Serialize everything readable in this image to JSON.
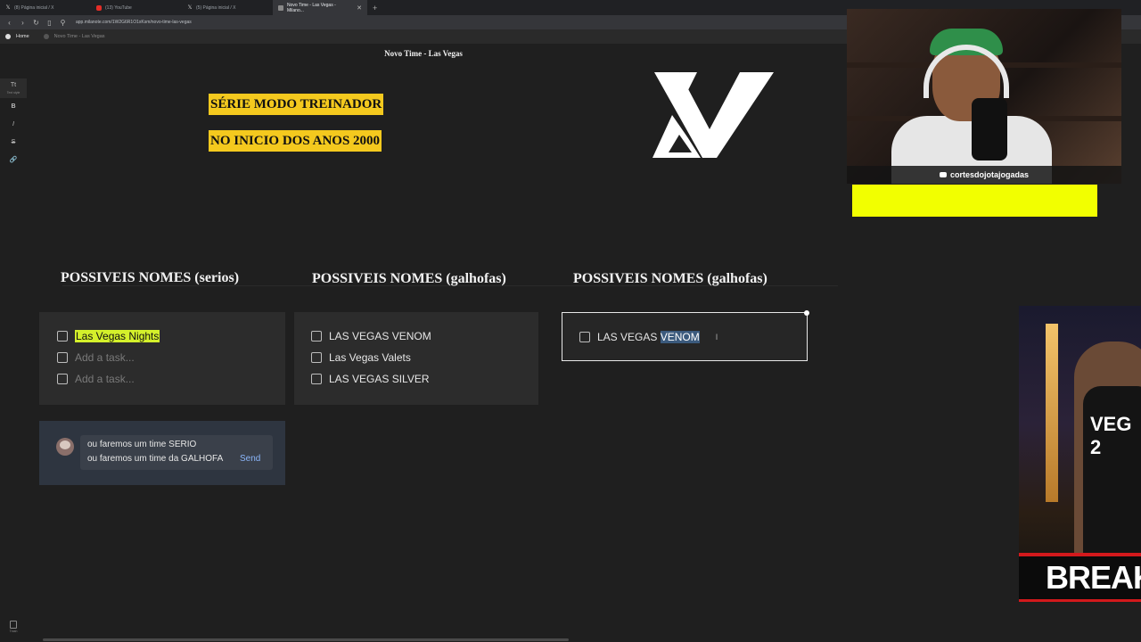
{
  "browser": {
    "tabs": [
      {
        "title": "(8) Página inicial / X",
        "icon": "x-icon"
      },
      {
        "title": "(13) YouTube",
        "icon": "youtube-icon"
      },
      {
        "title": "(5) Página inicial / X",
        "icon": "x-icon"
      },
      {
        "title": "Novo Time - Las Vegas - Milano...",
        "icon": "milanote-icon",
        "active": true
      }
    ],
    "url": "app.milanote.com/1W2G6R1O1xKsm/novo-time-las-vegas",
    "breadcrumb": {
      "home": "Home",
      "current": "Novo Time - Las Vegas"
    }
  },
  "app": {
    "board_title": "Novo Time - Las Vegas",
    "toolbar": [
      {
        "icon": "text-style-icon",
        "label": "Tt",
        "caption": "Text style"
      },
      {
        "icon": "bold-icon",
        "label": "B"
      },
      {
        "icon": "italic-icon",
        "label": "I"
      },
      {
        "icon": "strikethrough-icon",
        "label": "S"
      },
      {
        "icon": "link-icon",
        "label": "🔗"
      }
    ],
    "banners": [
      "SÉRIE MODO TREINADOR",
      "NO INICIO DOS ANOS 2000"
    ],
    "columns": [
      {
        "title": "POSSIVEIS NOMES (serios)",
        "tasks": [
          {
            "text": "Las Vegas Nights",
            "highlight": true
          },
          {
            "text": "Add a task...",
            "placeholder": true
          },
          {
            "text": "Add a task...",
            "placeholder": true
          }
        ]
      },
      {
        "title": "POSSIVEIS NOMES (galhofas)",
        "tasks": [
          {
            "text": "LAS VEGAS VENOM"
          },
          {
            "text": "Las Vegas Valets"
          },
          {
            "text": "LAS VEGAS SILVER"
          }
        ]
      },
      {
        "title": "POSSIVEIS NOMES (galhofas)",
        "tasks": [
          {
            "text_before": "LAS VEGAS ",
            "text_selected": "VENOM"
          }
        ]
      }
    ],
    "comment": {
      "lines": [
        "ou faremos um time SERIO",
        "ou faremos um time da GALHOFA"
      ],
      "send_label": "Send"
    },
    "trash_label": "Trash"
  },
  "overlays": {
    "channel_handle": "cortesdojotajogadas",
    "promo_text": "BREAKIN",
    "promo_jersey": "VEG\n2"
  },
  "colors": {
    "banner": "#f4c91e",
    "highlight": "#d4f02b",
    "overlay_bar": "#f2ff00",
    "breaking_red": "#d3191c"
  }
}
